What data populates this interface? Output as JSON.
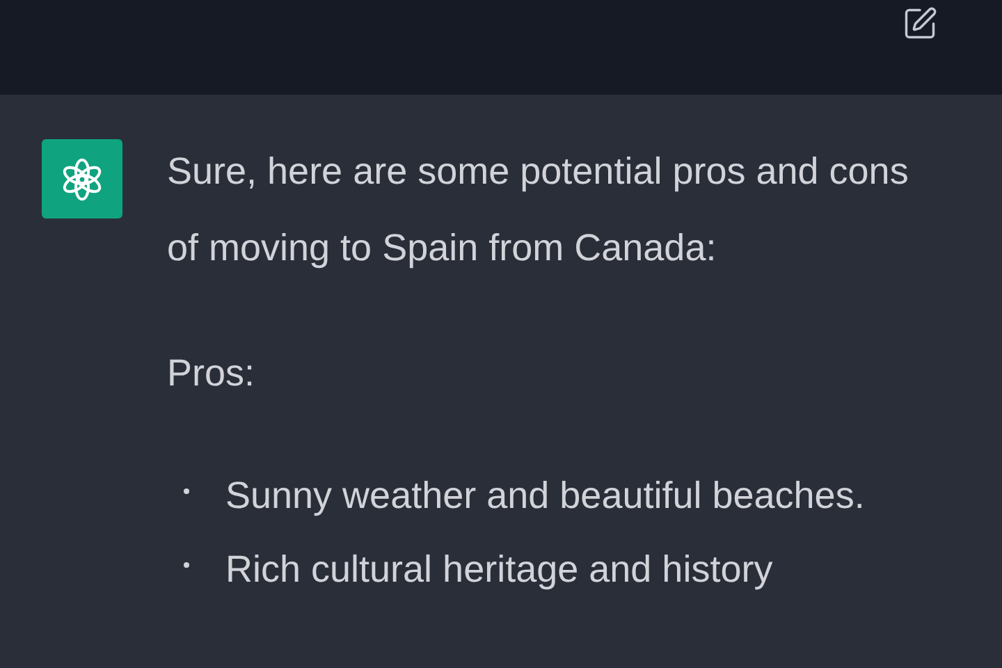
{
  "message": {
    "paragraphs": [
      "Sure, here are some potential pros and cons of moving to Spain from Canada:",
      "Pros:"
    ],
    "bullets": [
      "Sunny weather and beautiful beaches.",
      "Rich cultural heritage and history"
    ]
  }
}
